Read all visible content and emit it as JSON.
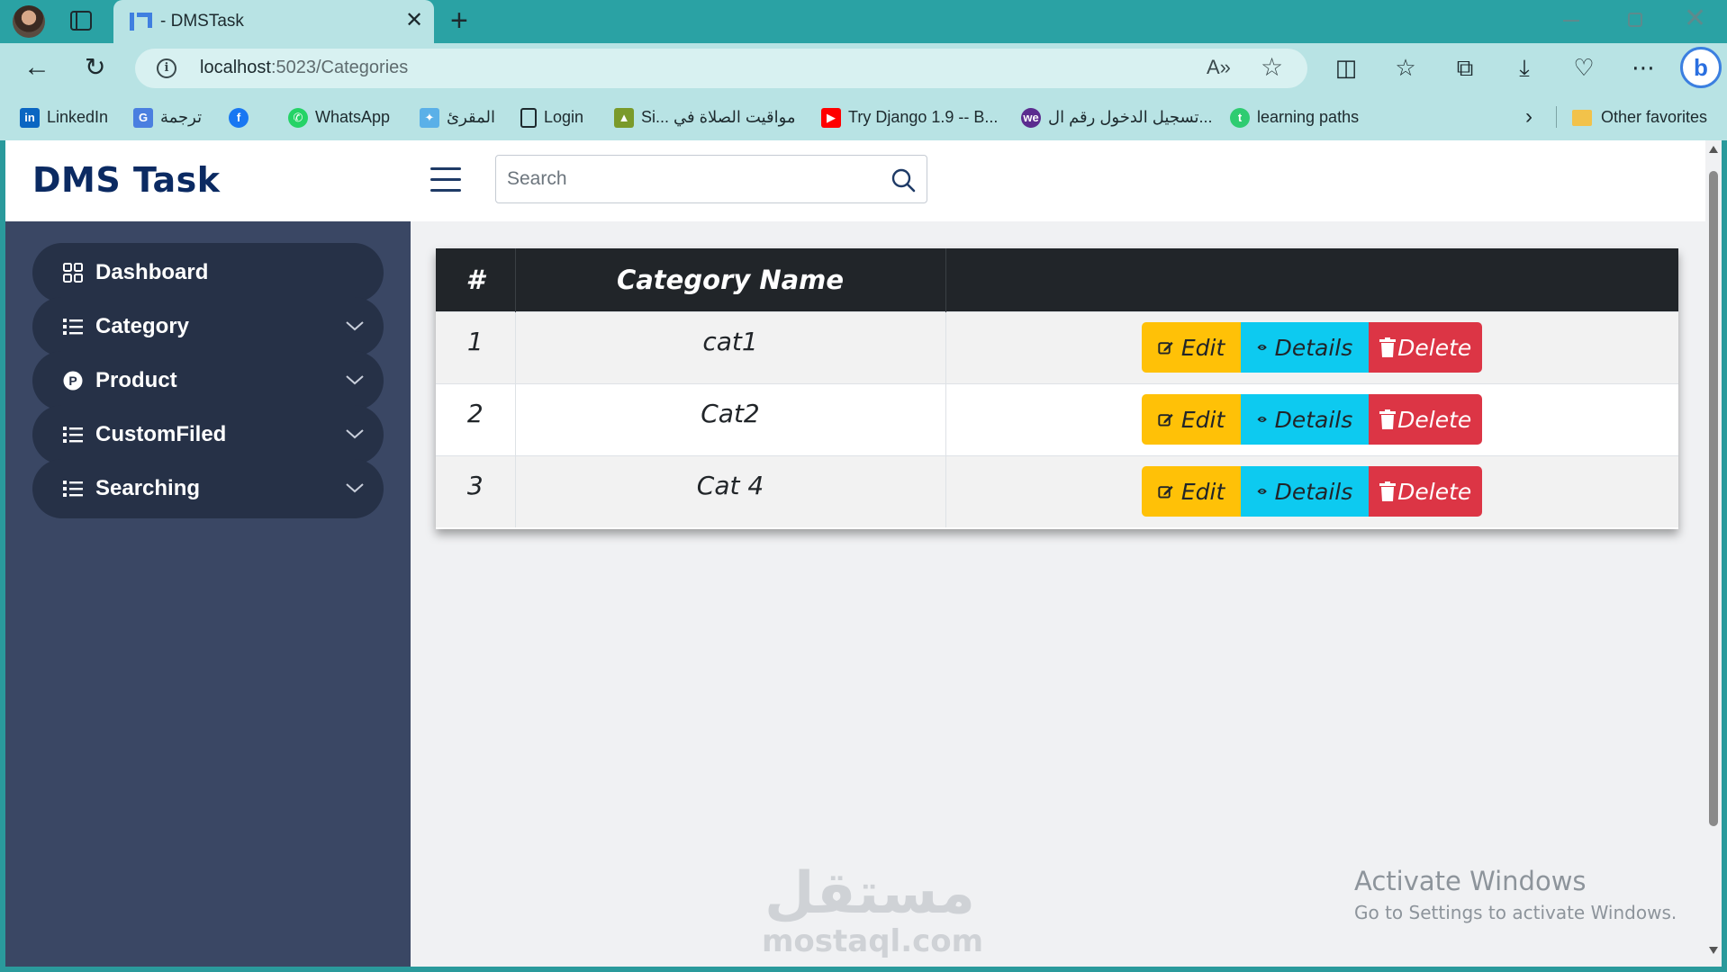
{
  "browser": {
    "tab_title": "- DMSTask",
    "url_host": "localhost",
    "url_rest": ":5023/Categories",
    "bookmarks": [
      {
        "label": "LinkedIn",
        "icon": "linkedin-icon"
      },
      {
        "label": "ترجمة",
        "icon": "google-translate-icon"
      },
      {
        "label": "",
        "icon": "facebook-icon"
      },
      {
        "label": "WhatsApp",
        "icon": "whatsapp-icon"
      },
      {
        "label": "المقرئ",
        "icon": "almuqri-icon"
      },
      {
        "label": "Login",
        "icon": "page-icon"
      },
      {
        "label": "Si... مواقيت الصلاة في",
        "icon": "mosque-icon"
      },
      {
        "label": "Try Django 1.9 -- B...",
        "icon": "youtube-icon"
      },
      {
        "label": "تسجيل الدخول رقم ال...",
        "icon": "we-icon"
      },
      {
        "label": "learning paths",
        "icon": "learning-icon"
      }
    ],
    "other_favorites": "Other favorites"
  },
  "app": {
    "brand": "DMS Task",
    "search_placeholder": "Search"
  },
  "sidebar": {
    "items": [
      {
        "label": "Dashboard",
        "icon": "grid-icon",
        "has_chevron": false
      },
      {
        "label": "Category",
        "icon": "list-icon",
        "has_chevron": true
      },
      {
        "label": "Product",
        "icon": "product-p-icon",
        "has_chevron": true
      },
      {
        "label": "CustomFiled",
        "icon": "list-icon",
        "has_chevron": true
      },
      {
        "label": "Searching",
        "icon": "list-icon",
        "has_chevron": true
      }
    ]
  },
  "table": {
    "headers": [
      "#",
      "Category Name",
      ""
    ],
    "rows": [
      {
        "num": "1",
        "name": "cat1"
      },
      {
        "num": "2",
        "name": "Cat2"
      },
      {
        "num": "3",
        "name": "Cat 4"
      }
    ],
    "actions": {
      "edit": "Edit",
      "details": "Details",
      "delete": "Delete"
    }
  },
  "overlay": {
    "watermark_ar": "مستقل",
    "watermark_en": "mostaql.com",
    "activate_title": "Activate Windows",
    "activate_sub": "Go to Settings to activate Windows."
  },
  "colors": {
    "brand": "#0b2a62",
    "sidebar_bg": "#3a4764",
    "sidebar_item_bg": "#263147",
    "table_header_bg": "#212529",
    "edit": "#ffc107",
    "details": "#0dcaf0",
    "delete": "#dc3545"
  }
}
